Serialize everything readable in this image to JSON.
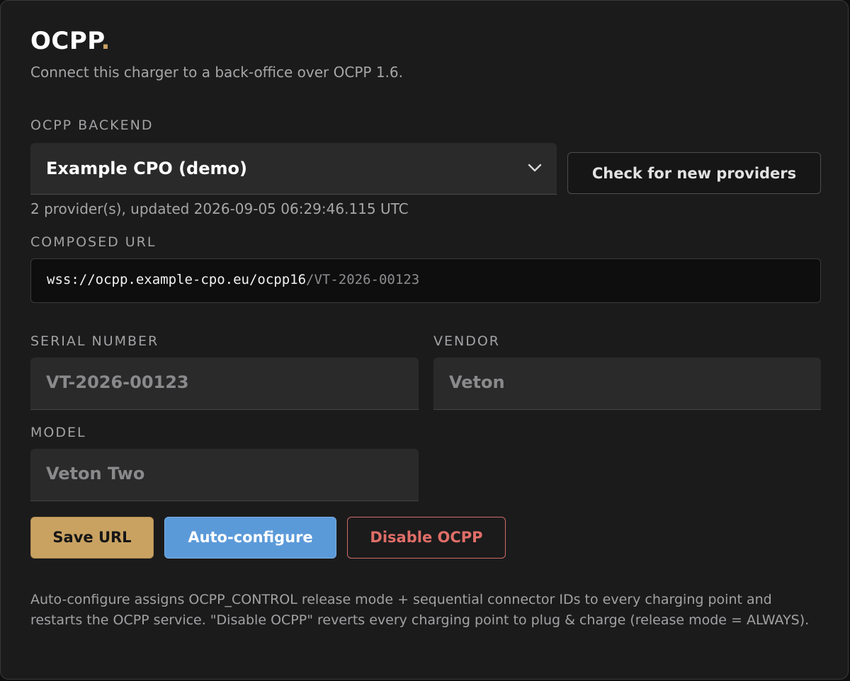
{
  "header": {
    "title": "OCPP",
    "title_dot": ".",
    "subtitle": "Connect this charger to a back-office over OCPP 1.6."
  },
  "backend": {
    "label": "OCPP BACKEND",
    "selected": "Example CPO (demo)",
    "check_button": "Check for new providers",
    "status": "2 provider(s), updated 2026-09-05 06:29:46.115 UTC"
  },
  "composed_url": {
    "label": "COMPOSED URL",
    "base": "wss://ocpp.example-cpo.eu/ocpp16",
    "suffix": "/VT-2026-00123"
  },
  "fields": {
    "serial": {
      "label": "SERIAL NUMBER",
      "value": "VT-2026-00123"
    },
    "vendor": {
      "label": "VENDOR",
      "value": "Veton"
    },
    "model": {
      "label": "MODEL",
      "value": "Veton Two"
    }
  },
  "actions": {
    "save": "Save URL",
    "auto": "Auto-configure",
    "disable": "Disable OCPP"
  },
  "note": "Auto-configure assigns OCPP_CONTROL release mode + sequential connector IDs to every charging point and restarts the OCPP service. \"Disable OCPP\" reverts every charging point to plug & charge (release mode = ALWAYS).",
  "colors": {
    "accent_gold": "#c9a262",
    "primary_blue": "#5b9ad9",
    "danger_red": "#e06e68"
  },
  "icons": {
    "dropdown": "chevron-down-icon"
  }
}
